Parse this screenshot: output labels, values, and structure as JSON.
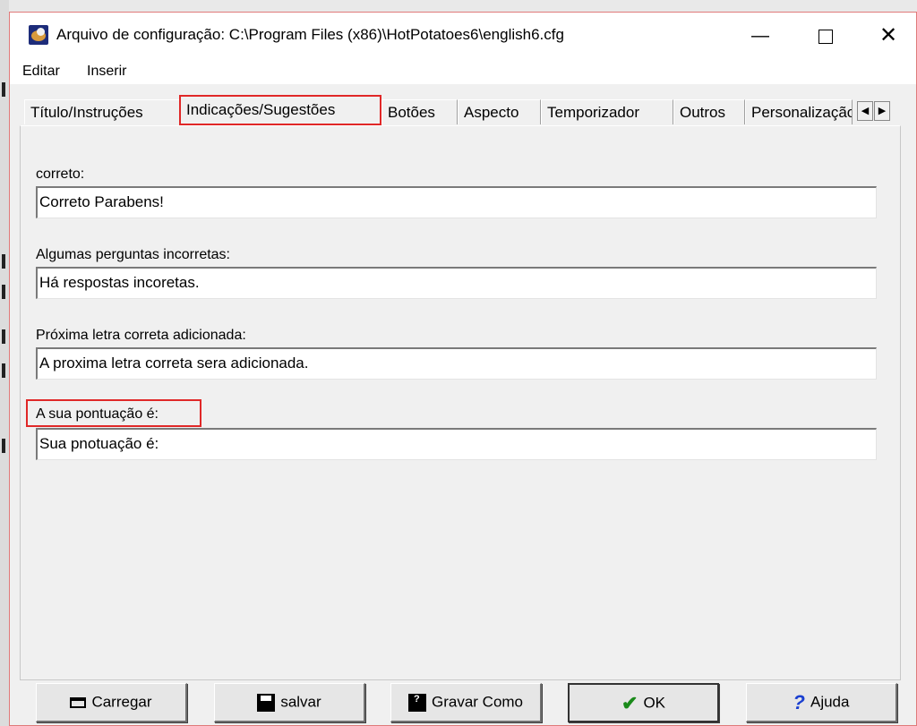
{
  "window": {
    "title": "Arquivo de configuração: C:\\Program Files (x86)\\HotPotatoes6\\english6.cfg",
    "minimize": "—",
    "close": "✕"
  },
  "menu": {
    "editar": "Editar",
    "inserir": "Inserir"
  },
  "tabs": [
    {
      "label": "Título/Instruções",
      "active": false
    },
    {
      "label": "Indicações/Sugestões",
      "active": true
    },
    {
      "label": "Botões",
      "active": false
    },
    {
      "label": "Aspecto",
      "active": false
    },
    {
      "label": "Temporizador",
      "active": false
    },
    {
      "label": "Outros",
      "active": false
    },
    {
      "label": "Personalização",
      "active": false
    }
  ],
  "tab_scroll": {
    "left": "◀",
    "right": "▶"
  },
  "fields": [
    {
      "label": "correto:",
      "value": "Correto Parabens!"
    },
    {
      "label": "Algumas perguntas incorretas:",
      "value": "Há respostas incoretas."
    },
    {
      "label": "Próxima letra correta adicionada:",
      "value": "A proxima letra correta sera adicionada."
    },
    {
      "label": "A sua pontuação é:",
      "value": "Sua pnotuação é:"
    }
  ],
  "buttons": {
    "carregar": "Carregar",
    "salvar": "salvar",
    "gravar": "Gravar Como",
    "ok": "OK",
    "ajuda": "Ajuda"
  },
  "icons": {
    "ok": "✔",
    "ajuda": "?"
  },
  "colors": {
    "highlight": "#e02828",
    "ok_check": "#1a8a1a",
    "help_icon": "#1a3fd0"
  }
}
